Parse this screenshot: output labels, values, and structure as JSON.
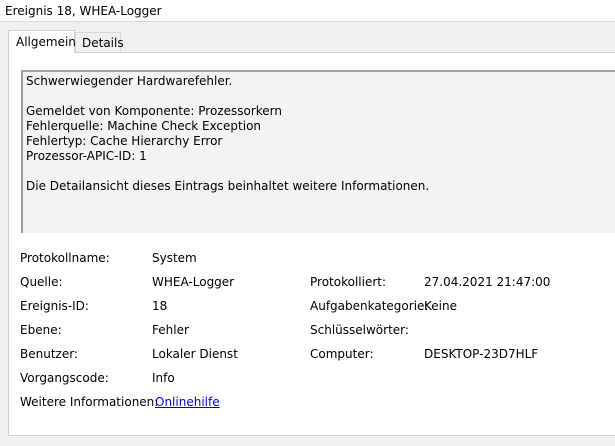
{
  "window": {
    "title": "Ereignis 18, WHEA-Logger"
  },
  "tabs": [
    {
      "label": "Allgemein",
      "active": true
    },
    {
      "label": "Details",
      "active": false
    }
  ],
  "description": {
    "lines": [
      "Schwerwiegender Hardwarefehler.",
      "",
      "Gemeldet von Komponente: Prozessorkern",
      "Fehlerquelle: Machine Check Exception",
      "Fehlertyp: Cache Hierarchy Error",
      "Prozessor-APIC-ID: 1",
      "",
      "Die Detailansicht dieses Eintrags beinhaltet weitere Informationen."
    ]
  },
  "fields": {
    "protokollname": {
      "label": "Protokollname:",
      "value": "System"
    },
    "quelle": {
      "label": "Quelle:",
      "value": "WHEA-Logger"
    },
    "protokolliert": {
      "label": "Protokolliert:",
      "value": "27.04.2021 21:47:00"
    },
    "ereignis_id": {
      "label": "Ereignis-ID:",
      "value": "18"
    },
    "aufgabenkategorie": {
      "label": "Aufgabenkategorie:",
      "value": "Keine"
    },
    "ebene": {
      "label": "Ebene:",
      "value": "Fehler"
    },
    "schluesselwoerter": {
      "label": "Schlüsselwörter:",
      "value": ""
    },
    "benutzer": {
      "label": "Benutzer:",
      "value": "Lokaler Dienst"
    },
    "computer": {
      "label": "Computer:",
      "value": "DESKTOP-23D7HLF"
    },
    "vorgangscode": {
      "label": "Vorgangscode:",
      "value": "Info"
    },
    "weitere_informationen": {
      "label": "Weitere Informationen:",
      "value": "Onlinehilfe"
    }
  },
  "colors": {
    "link": "#0000ee",
    "background": "#f0f0f0"
  }
}
